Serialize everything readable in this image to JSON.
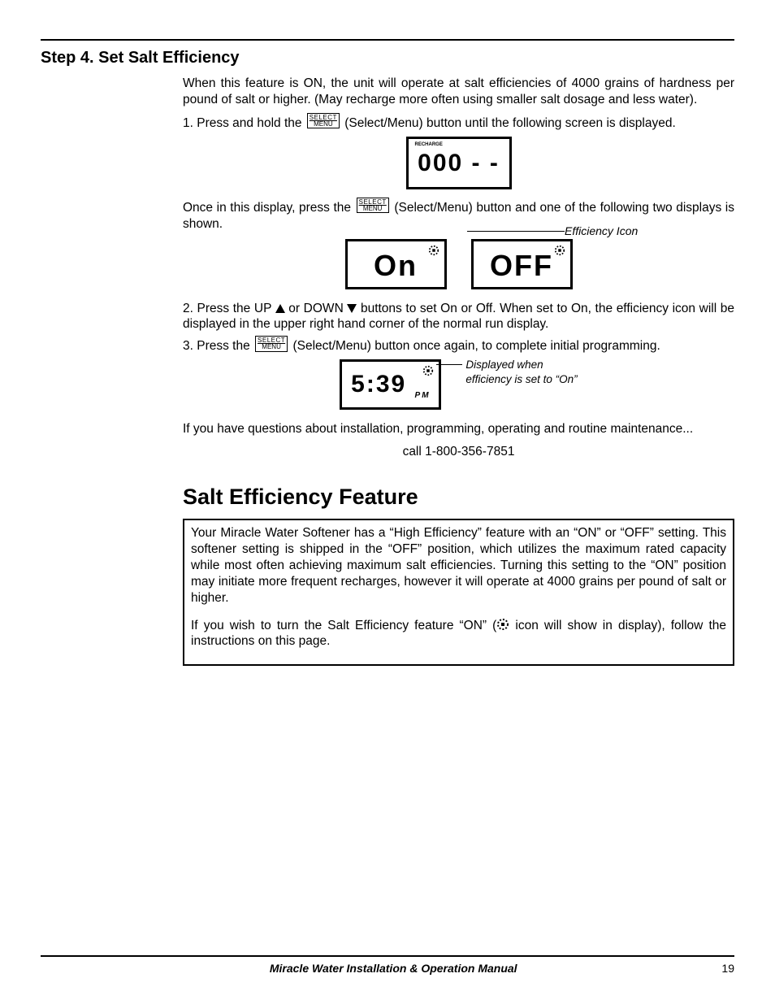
{
  "step": {
    "title": "Step 4. Set Salt Efficiency",
    "intro": "When this feature is ON, the unit will operate at salt efficiencies of 4000 grains of hardness per pound of salt or higher. (May recharge more often using smaller salt dosage and less water).",
    "li1_a": "1. Press and hold the ",
    "li1_b": " (Select/Menu) button until the following screen is displayed.",
    "mid_a": "Once in this display, press the ",
    "mid_b": " (Select/Menu) button and one of the following two displays is shown.",
    "eff_icon_label": "Efficiency Icon",
    "li2": "2. Press the UP ▲ or DOWN ▼ buttons to set On or Off.  When set to On, the efficiency icon will be displayed in the upper right hand corner of the normal run display.",
    "li2_a": "2. Press the UP ",
    "li2_b": " or DOWN ",
    "li2_c": " buttons to set On or Off.  When set to On, the efficiency icon will be displayed in the upper right hand corner of the normal run display.",
    "li3_a": "3. Press the ",
    "li3_b": " (Select/Menu) button once again, to complete initial programming.",
    "clock_ann1": "Displayed when",
    "clock_ann2": "efficiency is set to “On”",
    "questions": "If you have questions about installation, programming, operating and routine maintenance...",
    "call": "call 1-800-356-7851"
  },
  "lcd": {
    "code": "000 - -",
    "code_tiny": "RECHARGE",
    "on": "On",
    "off": "OFF",
    "clock": "5:39",
    "clock_pm": "PM"
  },
  "button": {
    "top": "SELECT",
    "bottom": "MENU"
  },
  "sef": {
    "title": "Salt Efficiency Feature",
    "p1": "Your Miracle Water Softener has a “High Efficiency” feature with an “ON” or “OFF” setting. This softener setting is shipped in the “OFF” position, which utilizes the maximum rated capacity while most often achieving maximum salt efficiencies. Turning this setting to the “ON” position may initiate more frequent recharges, however it will operate at 4000 grains per pound of salt or higher.",
    "p2a": "If you wish to turn the Salt Efficiency feature “ON” (",
    "p2b": " icon will show in display), follow the instructions on this page."
  },
  "footer": {
    "title": "Miracle Water Installation & Operation Manual",
    "page": "19"
  }
}
